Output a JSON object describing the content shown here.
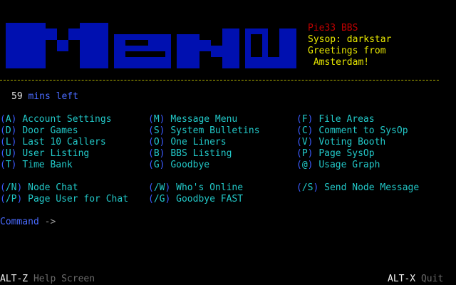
{
  "header": {
    "bbs_name": "Pie33 BBS",
    "sysop": "Sysop: darkstar",
    "greeting_line1": "Greetings from",
    "greeting_line2": " Amsterdam!",
    "logo_alt": "MENU"
  },
  "status": {
    "minutes": "59",
    "minutes_label": "mins left"
  },
  "menu": {
    "col1": [
      {
        "key": "A",
        "label": "Account Settings"
      },
      {
        "key": "D",
        "label": "Door Games"
      },
      {
        "key": "L",
        "label": "Last 10 Callers"
      },
      {
        "key": "U",
        "label": "User Listing"
      },
      {
        "key": "T",
        "label": "Time Bank"
      }
    ],
    "col2": [
      {
        "key": "M",
        "label": "Message Menu"
      },
      {
        "key": "S",
        "label": "System Bulletins"
      },
      {
        "key": "O",
        "label": "One Liners"
      },
      {
        "key": "B",
        "label": "BBS Listing"
      },
      {
        "key": "G",
        "label": "Goodbye"
      }
    ],
    "col3": [
      {
        "key": "F",
        "label": "File Areas"
      },
      {
        "key": "C",
        "label": "Comment to SysOp"
      },
      {
        "key": "V",
        "label": "Voting Booth"
      },
      {
        "key": "P",
        "label": "Page SysOp"
      },
      {
        "key": "@",
        "label": "Usage Graph"
      }
    ],
    "slash": [
      {
        "key": "/N",
        "label": "Node Chat"
      },
      {
        "key": "/W",
        "label": "Who's Online"
      },
      {
        "key": "/S",
        "label": "Send Node Message"
      },
      {
        "key": "/P",
        "label": "Page User for Chat"
      },
      {
        "key": "/G",
        "label": "Goodbye FAST"
      }
    ]
  },
  "prompt": {
    "label": "Command",
    "arrow": " ->"
  },
  "footer": {
    "help_key": "ALT-Z",
    "help_label": " Help Screen",
    "quit_key": "ALT-X",
    "quit_label": " Quit"
  },
  "colors": {
    "logo": "#0010b0",
    "bbs_name": "#c00000",
    "sysop": "#e8e800",
    "menu_key": "#22c8c8",
    "paren": "#3b5bff",
    "prompt": "#4a6bff"
  }
}
